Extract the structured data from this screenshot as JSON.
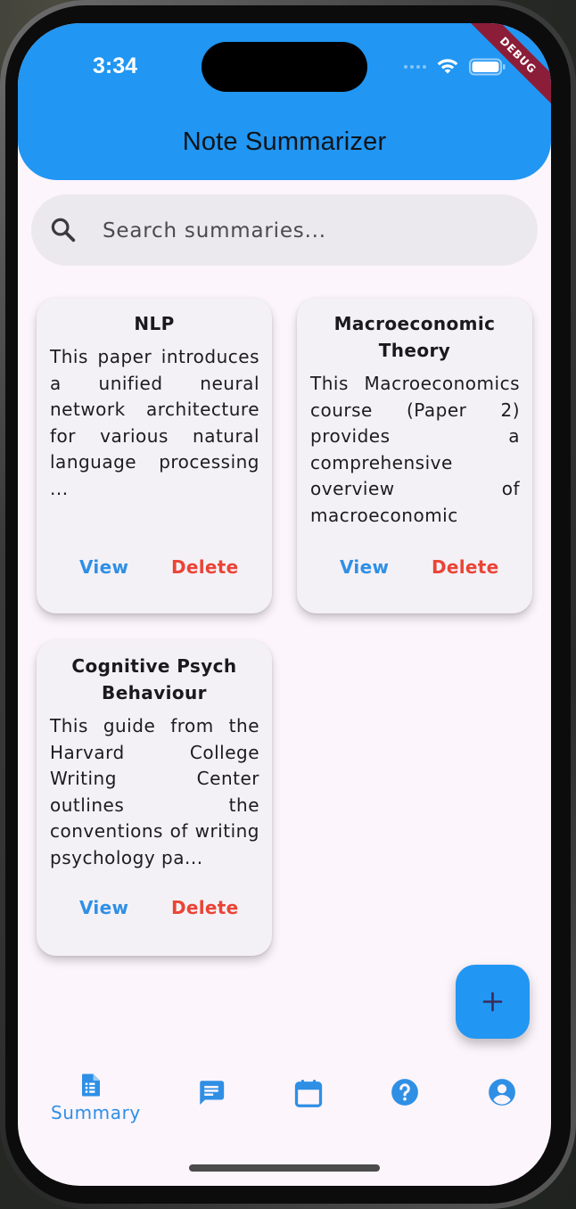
{
  "status_bar": {
    "time": "3:34",
    "debug_banner": "DEBUG"
  },
  "app_bar": {
    "title": "Note Summarizer",
    "color": "#2196f3"
  },
  "search": {
    "placeholder": "Search summaries...",
    "value": ""
  },
  "cards": [
    {
      "title": "NLP",
      "body": "This paper introduces a unified neural network architecture for various natural language processing ...",
      "view_label": "View",
      "delete_label": "Delete"
    },
    {
      "title": "Macroeconomic Theory",
      "body": "This Macroeconomics course (Paper 2) provides a comprehensive overview of macroeconomic",
      "view_label": "View",
      "delete_label": "Delete"
    },
    {
      "title": "Cognitive Psych Behaviour",
      "body": "This guide from the Harvard College Writing Center outlines the conventions of writing psychology pa...",
      "view_label": "View",
      "delete_label": "Delete"
    }
  ],
  "fab": {
    "icon": "plus-icon"
  },
  "bottom_nav": {
    "items": [
      {
        "label": "Summary",
        "icon": "summary-document-icon",
        "active": true
      },
      {
        "label": "",
        "icon": "chat-icon",
        "active": false
      },
      {
        "label": "",
        "icon": "calendar-icon",
        "active": false
      },
      {
        "label": "",
        "icon": "help-icon",
        "active": false
      },
      {
        "label": "",
        "icon": "profile-icon",
        "active": false
      }
    ],
    "accent": "#2f8fe5"
  },
  "colors": {
    "view": "#2f8fe5",
    "delete": "#ea4436",
    "background": "#fcf5fc"
  }
}
